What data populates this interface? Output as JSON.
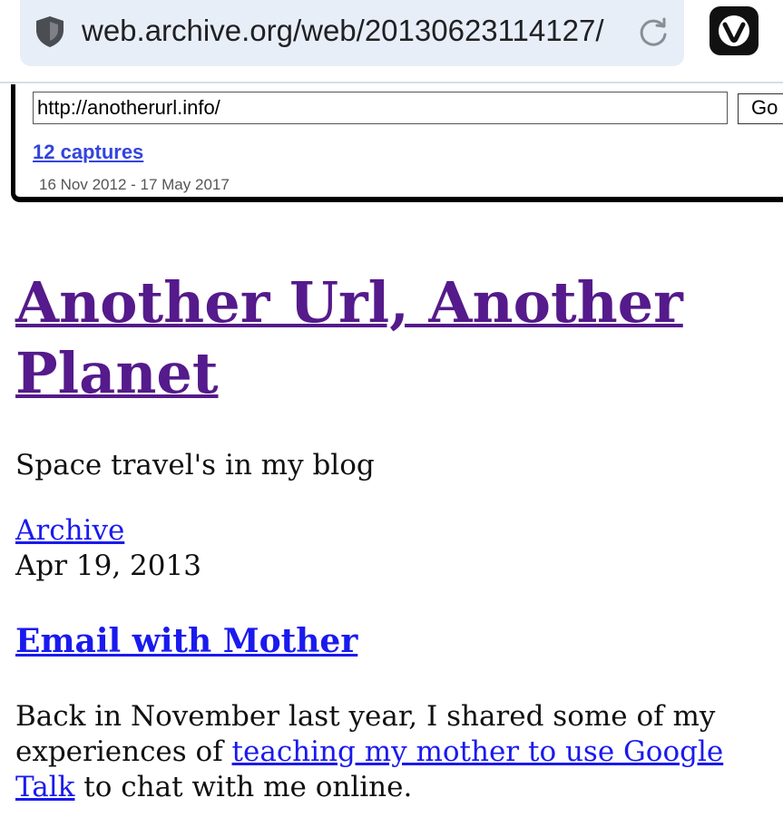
{
  "browser": {
    "address": "web.archive.org/web/20130623114127/",
    "icons": {
      "security": "shield-icon",
      "reload": "reload-icon",
      "browser_logo": "vivaldi-icon"
    }
  },
  "wayback": {
    "url_value": "http://anotherurl.info/",
    "go_label": "Go",
    "captures_label": "12 captures",
    "date_range": "16 Nov 2012 - 17 May 2017"
  },
  "site": {
    "title": "Another Url, Another Planet",
    "tagline": "Space travel's in my blog",
    "archive_label": "Archive"
  },
  "post": {
    "date": "Apr 19, 2013",
    "title": "Email with Mother",
    "body_before": "Back in November last year, I shared some of my experiences of ",
    "body_link": "teaching my mother to use Google Talk",
    "body_after": " to chat with me online."
  },
  "colors": {
    "visited_link": "#551a8b",
    "link": "#1a1aee",
    "wayback_link": "#3344dd",
    "address_bar_bg": "#e8eef8"
  }
}
